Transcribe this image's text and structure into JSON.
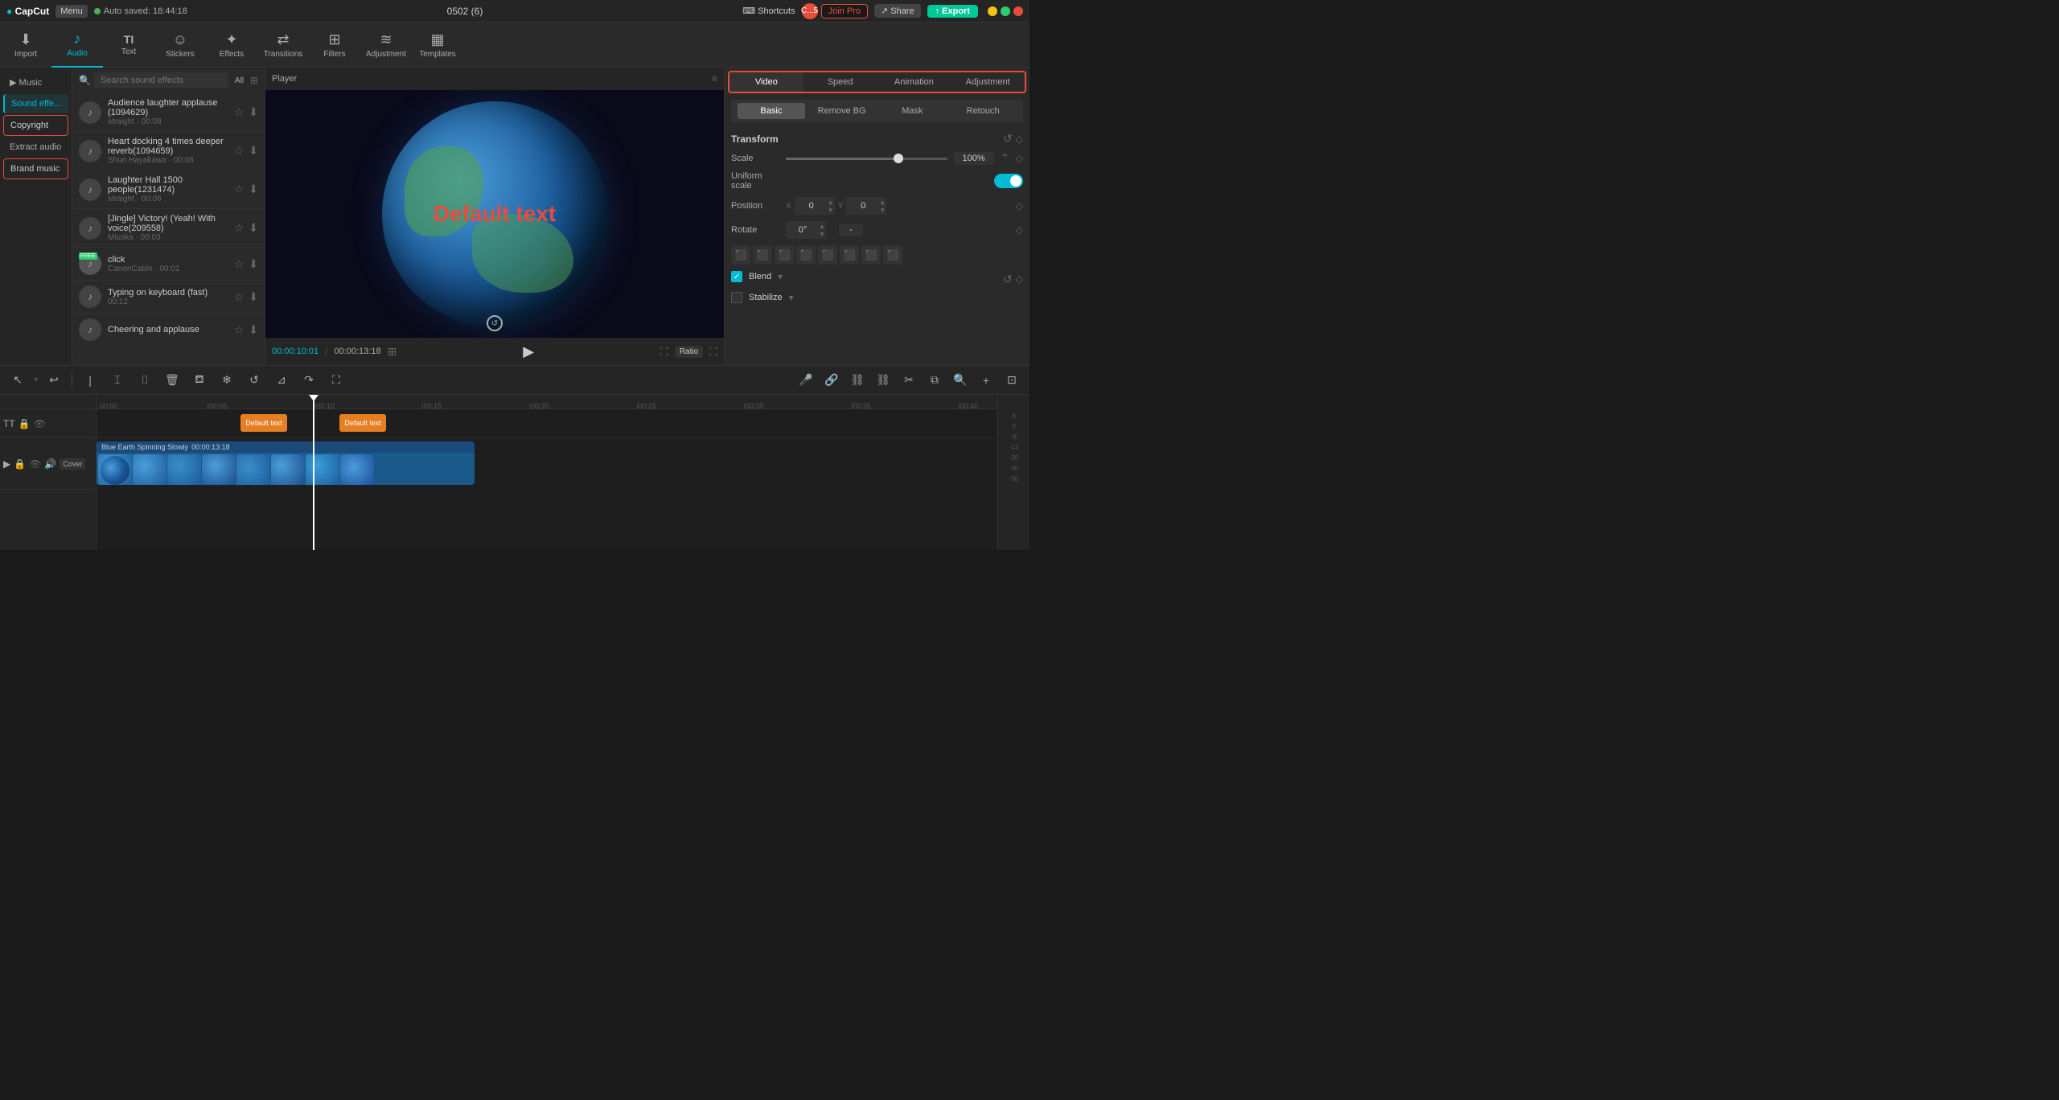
{
  "app": {
    "name": "CapCut",
    "menu_label": "Menu",
    "auto_save": "Auto saved: 18:44:18",
    "project_name": "0502 (6)"
  },
  "top_bar": {
    "shortcuts": "Shortcuts",
    "user_initial": "C...5",
    "join_pro": "Join Pro",
    "share": "Share",
    "export": "Export"
  },
  "toolbar": {
    "items": [
      {
        "id": "import",
        "label": "Import",
        "icon": "↓"
      },
      {
        "id": "audio",
        "label": "Audio",
        "icon": "♪",
        "active": true
      },
      {
        "id": "text",
        "label": "Text",
        "icon": "TI"
      },
      {
        "id": "stickers",
        "label": "Stickers",
        "icon": "☺"
      },
      {
        "id": "effects",
        "label": "Effects",
        "icon": "✦"
      },
      {
        "id": "transitions",
        "label": "Transitions",
        "icon": "⇄"
      },
      {
        "id": "filters",
        "label": "Filters",
        "icon": "⊞"
      },
      {
        "id": "adjustment",
        "label": "Adjustment",
        "icon": "≋"
      },
      {
        "id": "templates",
        "label": "Templates",
        "icon": "▦"
      }
    ]
  },
  "sidebar": {
    "items": [
      {
        "id": "music",
        "label": "Music",
        "active": false
      },
      {
        "id": "sound-effects",
        "label": "Sound effe...",
        "active": true
      },
      {
        "id": "copyright",
        "label": "Copyright",
        "highlighted": true
      },
      {
        "id": "extract-audio",
        "label": "Extract audio"
      },
      {
        "id": "brand-music",
        "label": "Brand music",
        "highlighted": true
      }
    ]
  },
  "search": {
    "placeholder": "Search sound effects",
    "all_label": "All"
  },
  "sound_list": [
    {
      "id": 1,
      "name": "Audience laughter applause (1094629)",
      "meta": "straight · 00:08"
    },
    {
      "id": 2,
      "name": "Heart docking 4 times deeper reverb(1094659)",
      "meta": "Shun Hayakawa · 00:08"
    },
    {
      "id": 3,
      "name": "Laughter Hall 1500 people(1231474)",
      "meta": "straight · 00:06"
    },
    {
      "id": 4,
      "name": "[Jingle] Victory! (Yeah! With voice(209558)",
      "meta": "Misoka · 00:03"
    },
    {
      "id": 5,
      "name": "click",
      "meta": "CanonCable · 00:01",
      "has_badge": true
    },
    {
      "id": 6,
      "name": "Typing on keyboard (fast)",
      "meta": "00:12"
    },
    {
      "id": 7,
      "name": "Cheering and applause",
      "meta": ""
    }
  ],
  "player": {
    "title": "Player",
    "time_current": "00:00:10:01",
    "time_total": "00:00:13:18",
    "ratio_label": "Ratio"
  },
  "right_panel": {
    "tabs": [
      "Video",
      "Speed",
      "Animation",
      "Adjustment"
    ],
    "active_tab": "Video",
    "subtabs": [
      "Basic",
      "Remove BG",
      "Mask",
      "Retouch"
    ],
    "active_subtab": "Basic"
  },
  "transform": {
    "section_label": "Transform",
    "scale_label": "Scale",
    "scale_value": "100%",
    "uniform_scale_label": "Uniform scale",
    "position_label": "Position",
    "pos_x": "0",
    "pos_y": "0",
    "rotate_label": "Rotate",
    "rotate_value": "0°",
    "rotate_dash": "-"
  },
  "blend": {
    "label": "Blend"
  },
  "stabilize": {
    "label": "Stabilize"
  },
  "timeline": {
    "ruler_marks": [
      "00:00",
      "|00:05",
      "|00:10",
      "|00:15",
      "|00:20",
      "|00:25",
      "|00:30",
      "|00:35",
      "|00:40"
    ],
    "video_clip": {
      "label": "Blue Earth Spinning Slowly",
      "duration": "00:00:13:18"
    },
    "text_clips": [
      {
        "label": "Default text"
      },
      {
        "label": "Default text"
      }
    ],
    "cover_label": "Cover"
  }
}
